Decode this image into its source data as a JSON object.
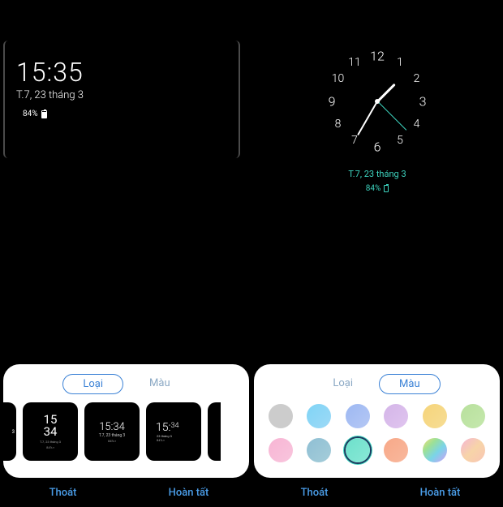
{
  "left_screen": {
    "time": "15:35",
    "date": "T.7, 23 tháng 3",
    "battery": "84%"
  },
  "right_screen": {
    "clock_numbers": [
      "12",
      "1",
      "2",
      "3",
      "4",
      "5",
      "6",
      "7",
      "8",
      "9",
      "10",
      "11"
    ],
    "date": "T.7, 23 tháng 3",
    "battery": "84%"
  },
  "panel_left": {
    "tabs": {
      "type": "Loại",
      "color": "Màu"
    },
    "active_tab": "type",
    "thumbs": {
      "partial_left_text": "3",
      "t1_hour": "15",
      "t1_min": "34",
      "t1_sub": "T.7, 23 tháng 3",
      "t1_bat": "84% ▪",
      "t2_time": "15:34",
      "t2_date": "T.7, 23 tháng 3",
      "t2_bat": "84% ▪",
      "t3_hour": "15:",
      "t3_min": "34",
      "t3_date": "23 tháng 3",
      "t3_bat": "84% ▪"
    }
  },
  "panel_right": {
    "tabs": {
      "type": "Loại",
      "color": "Màu"
    },
    "active_tab": "color",
    "swatches": [
      {
        "id": "c1",
        "bg": "#cccccc"
      },
      {
        "id": "c2",
        "bg": "linear-gradient(135deg,#7fd4f5,#9dd9f7)"
      },
      {
        "id": "c3",
        "bg": "linear-gradient(135deg,#9db8f2,#b5c8f5)"
      },
      {
        "id": "c4",
        "bg": "linear-gradient(135deg,#d4b5e8,#e0c5ef)"
      },
      {
        "id": "c5",
        "bg": "linear-gradient(135deg,#f5d47a,#f7dd95)"
      },
      {
        "id": "c6",
        "bg": "linear-gradient(135deg,#b8e09d,#c5e8ad)"
      },
      {
        "id": "c7",
        "bg": "linear-gradient(135deg,#f7b5d4,#f9c5dd)"
      },
      {
        "id": "c8",
        "bg": "linear-gradient(135deg,#8fbfd4,#a5cdd9)"
      },
      {
        "id": "c9",
        "bg": "linear-gradient(135deg,#6de0cb,#8ae8d6)",
        "selected": true
      },
      {
        "id": "c10",
        "bg": "linear-gradient(135deg,#f7a888,#f9b89d)"
      },
      {
        "id": "c11",
        "bg": "linear-gradient(135deg,#f5e07a 0%,#9de095 30%,#7ad4e8 60%,#d49df5 100%)"
      },
      {
        "id": "c12",
        "bg": "linear-gradient(135deg,#f5b5d4 0%,#f7d4a8 50%,#f9c5b5 100%)"
      }
    ]
  },
  "actions": {
    "exit": "Thoát",
    "done": "Hoàn tất"
  },
  "colors": {
    "accent": "#3dd4bf",
    "link": "#4a9de8",
    "pill_border": "#3b82d6"
  }
}
